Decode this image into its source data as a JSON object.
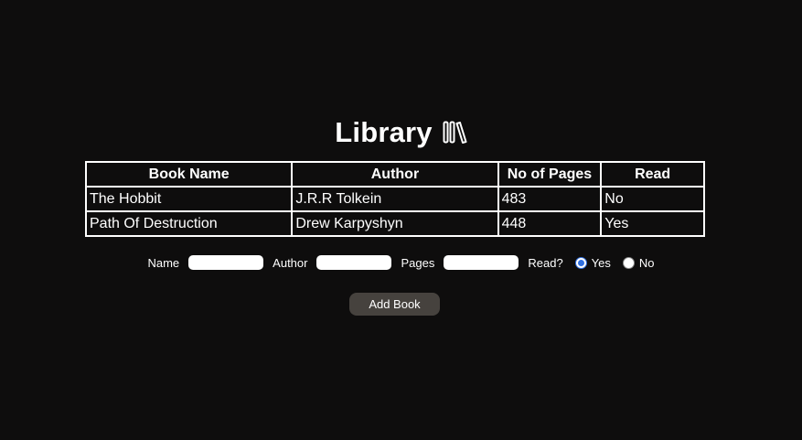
{
  "header": {
    "title": "Library",
    "icon": "books-icon"
  },
  "table": {
    "columns": [
      "Book Name",
      "Author",
      "No of Pages",
      "Read"
    ],
    "rows": [
      [
        "The Hobbit",
        "J.R.R Tolkein",
        "483",
        "No"
      ],
      [
        "Path Of Destruction",
        "Drew Karpyshyn",
        "448",
        "Yes"
      ]
    ]
  },
  "form": {
    "name_label": "Name",
    "name_value": "",
    "author_label": "Author",
    "author_value": "",
    "pages_label": "Pages",
    "pages_value": "",
    "read_label": "Read?",
    "read_yes_label": "Yes",
    "read_no_label": "No",
    "read_selected": "Yes",
    "submit_label": "Add Book"
  },
  "colors": {
    "background": "#0e0d0d",
    "button": "#46423e",
    "radio_accent": "#2f6fe0"
  }
}
